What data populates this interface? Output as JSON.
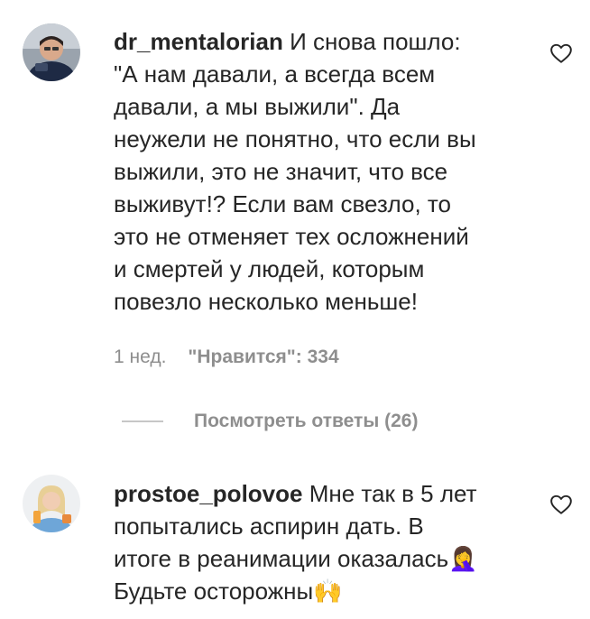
{
  "comments": [
    {
      "username": "dr_mentalorian",
      "lines": [
        "И снова пошло:",
        "\"А нам давали, а всегда всем",
        "давали, а мы выжили\". Да",
        "неужели не понятно, что если вы",
        "выжили, это не значит, что все",
        "выживут!? Если вам свезло, то",
        "это не отменяет тех осложнений",
        "и смертей у людей, которым",
        "повезло несколько меньше!"
      ],
      "time": "1 нед.",
      "likes": "\"Нравится\": 334",
      "view_replies": "Посмотреть ответы (26)"
    },
    {
      "username": "prostoe_polovoe",
      "lines": [
        "Мне так в 5 лет",
        "попытались аспирин дать. В",
        "итоге в реанимации оказалась🤦‍♀️",
        "Будьте осторожны🙌"
      ]
    }
  ],
  "icons": {
    "like": "heart-outline-icon"
  },
  "colors": {
    "text": "#262626",
    "secondary": "#8e8e8e",
    "divider": "#c7c7c7"
  }
}
